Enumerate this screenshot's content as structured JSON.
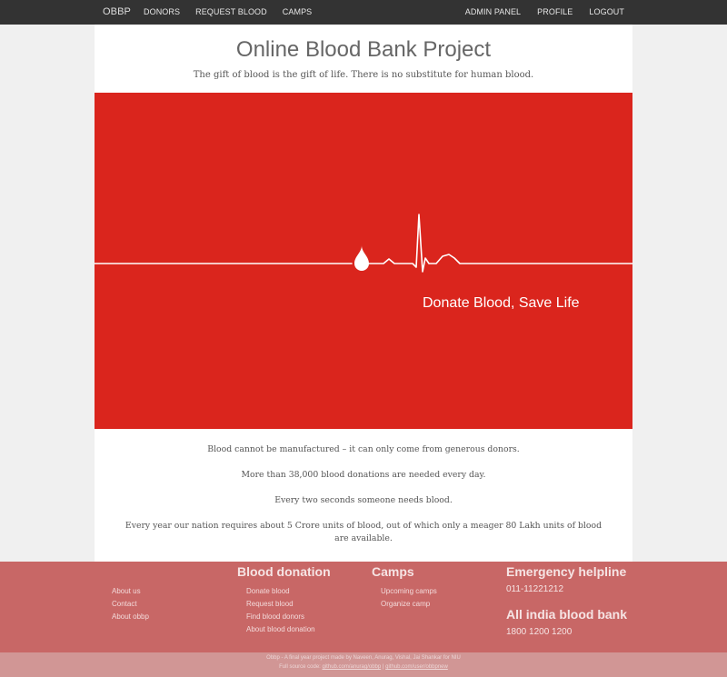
{
  "navbar": {
    "brand": "OBBP",
    "left_items": [
      "DONORS",
      "REQUEST BLOOD",
      "CAMPS"
    ],
    "right_items": [
      "ADMIN PANEL",
      "PROFILE",
      "LOGOUT"
    ]
  },
  "header": {
    "title": "Online Blood Bank Project",
    "tagline": "The gift of blood is the gift of life. There is no substitute for human blood."
  },
  "hero": {
    "slogan": "Donate Blood, Save Life",
    "background_color": "#da251d"
  },
  "facts": [
    "Blood cannot be manufactured – it can only come from generous donors.",
    "More than 38,000 blood donations are needed every day.",
    "Every two seconds someone needs blood.",
    "Every year our nation requires about 5 Crore units of blood, out of which only a meager 80 Lakh units of blood are available."
  ],
  "footer": {
    "about_links": [
      "About us",
      "Contact",
      "About obbp"
    ],
    "blood_donation": {
      "heading": "Blood donation",
      "links": [
        "Donate blood",
        "Request blood",
        "Find blood donors",
        "About blood donation"
      ]
    },
    "camps": {
      "heading": "Camps",
      "links": [
        "Upcoming camps",
        "Organize camp"
      ]
    },
    "emergency": {
      "heading": "Emergency helpline",
      "phone": "011-11221212"
    },
    "all_india": {
      "heading": "All india blood bank",
      "phone": "1800 1200 1200"
    },
    "background_color": "#c86766"
  },
  "bottombar": {
    "credit": "Obbp - A final year project made by Naveen, Anurag, Vishal, Jai Shankar for NIU",
    "source_prefix": "Full source code:",
    "source_link_1": "github.com/anurag/obbp",
    "source_sep": "|",
    "source_link_2": "github.com/user/obbpnew"
  }
}
